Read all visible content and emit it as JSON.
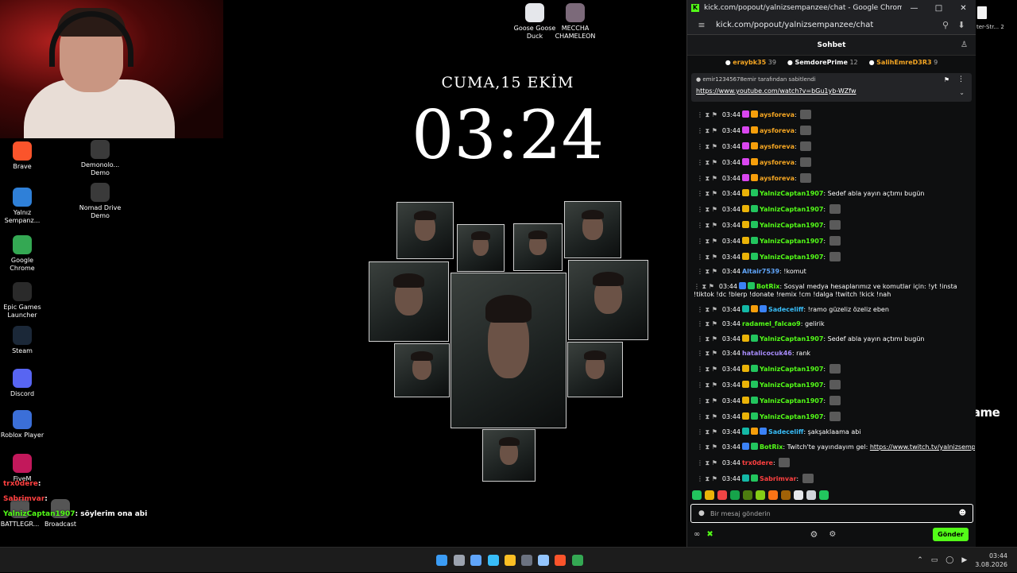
{
  "desktop": {
    "icons_left": [
      {
        "label": "Brave",
        "icon": "brave-icon",
        "color": "#fb542b"
      },
      {
        "label": "Yalnız Sempanz...",
        "icon": "chrome-icon",
        "color": "#2f80d8"
      },
      {
        "label": "Google Chrome",
        "icon": "chrome-icon",
        "color": "#34a853"
      },
      {
        "label": "Epic Games Launcher",
        "icon": "epic-games-icon",
        "color": "#2a2a2a"
      },
      {
        "label": "Steam",
        "icon": "steam-icon",
        "color": "#1b2838"
      },
      {
        "label": "Discord",
        "icon": "discord-icon",
        "color": "#5865f2"
      },
      {
        "label": "Roblox Player",
        "icon": "roblox-icon",
        "color": "#3b6fd8"
      },
      {
        "label": "FiveM",
        "icon": "fivem-icon",
        "color": "#c2185b"
      }
    ],
    "icons_col2": [
      {
        "label": "Demonolo... Demo",
        "icon": "demonologist-icon"
      },
      {
        "label": "Nomad Drive Demo",
        "icon": "nomad-drive-icon"
      }
    ],
    "icons_top": [
      {
        "label": "Goose Goose Duck",
        "icon": "goose-goose-duck-icon"
      },
      {
        "label": "MECCHA CHAMELEON",
        "icon": "meccha-chameleon-icon"
      }
    ],
    "icons_bottom": [
      {
        "label": "BATTLEGR...",
        "icon": "battlegrounds-icon"
      },
      {
        "label": "Broadcast",
        "icon": "broadcast-icon"
      }
    ],
    "clock": {
      "date": "CUMA,15 EKİM",
      "time": "03:24"
    },
    "overlay_chat": [
      {
        "user": "trx0dere",
        "sep": ":",
        "text": "",
        "color": "#ff4040"
      },
      {
        "user": "Sabrimvar",
        "sep": ":",
        "text": "",
        "color": "#ff4040"
      },
      {
        "user": "YalnizCaptan1907",
        "sep": ":",
        "text": "söylerim ona abi",
        "color": "#53fc18"
      }
    ],
    "edge_label": "ter-Str... 2",
    "watermark": "ByNoGame"
  },
  "chrome": {
    "window_title": "kick.com/popout/yalnizsempanzee/chat - Google Chrome",
    "url": "kick.com/popout/yalnizsempanzee/chat",
    "chat_title": "Sohbet",
    "leaderboard": [
      {
        "name": "eraybk35",
        "count": "39",
        "color": "#f5a623"
      },
      {
        "name": "SemdorePrime",
        "count": "12",
        "color": "#ffffff"
      },
      {
        "name": "SalihEmreD3R3",
        "count": "9",
        "color": "#f5a623"
      }
    ],
    "pinned": {
      "by": "emir12345678emir tarafından sabitlendi",
      "link": "https://www.youtube.com/watch?v=bGu1yb-WZfw"
    },
    "messages": [
      {
        "time": "03:44",
        "user": "aysforeva",
        "color": "#f5a623",
        "text": "",
        "emote": true,
        "badges": [
          "#d946ef",
          "#f59e0b"
        ]
      },
      {
        "time": "03:44",
        "user": "aysforeva",
        "color": "#f5a623",
        "text": "",
        "emote": true,
        "badges": [
          "#d946ef",
          "#f59e0b"
        ]
      },
      {
        "time": "03:44",
        "user": "aysforeva",
        "color": "#f5a623",
        "text": "",
        "emote": true,
        "badges": [
          "#d946ef",
          "#f59e0b"
        ]
      },
      {
        "time": "03:44",
        "user": "aysforeva",
        "color": "#f5a623",
        "text": "",
        "emote": true,
        "badges": [
          "#d946ef",
          "#f59e0b"
        ]
      },
      {
        "time": "03:44",
        "user": "aysforeva",
        "color": "#f5a623",
        "text": "",
        "emote": true,
        "badges": [
          "#d946ef",
          "#f59e0b"
        ]
      },
      {
        "time": "03:44",
        "user": "YalnizCaptan1907",
        "color": "#53fc18",
        "text": "Sedef abla yayın açtımı bugün",
        "emote": false,
        "badges": [
          "#eab308",
          "#22c55e"
        ]
      },
      {
        "time": "03:44",
        "user": "YalnizCaptan1907",
        "color": "#53fc18",
        "text": "",
        "emote": true,
        "badges": [
          "#eab308",
          "#22c55e"
        ]
      },
      {
        "time": "03:44",
        "user": "YalnizCaptan1907",
        "color": "#53fc18",
        "text": "",
        "emote": true,
        "badges": [
          "#eab308",
          "#22c55e"
        ]
      },
      {
        "time": "03:44",
        "user": "YalnizCaptan1907",
        "color": "#53fc18",
        "text": "",
        "emote": true,
        "badges": [
          "#eab308",
          "#22c55e"
        ]
      },
      {
        "time": "03:44",
        "user": "YalnizCaptan1907",
        "color": "#53fc18",
        "text": "",
        "emote": true,
        "badges": [
          "#eab308",
          "#22c55e"
        ]
      },
      {
        "time": "03:44",
        "user": "Altair7539",
        "color": "#60a5fa",
        "text": "!komut",
        "emote": false,
        "badges": []
      },
      {
        "time": "03:44",
        "user": "BotRix",
        "color": "#53fc18",
        "text": "Sosyal medya hesaplarımız ve komutlar için: !yt !insta !tiktok !dc !blerp !donate !remix !cm !dalga !twitch !kick !nah",
        "emote": false,
        "badges": [
          "#3b82f6",
          "#22c55e"
        ],
        "wrap": true
      },
      {
        "time": "03:44",
        "user": "Sadeceliff",
        "color": "#38bdf8",
        "text": "!ramo güzeliz özeliz eben",
        "emote": false,
        "badges": [
          "#14b8a6",
          "#f59e0b",
          "#3b82f6"
        ]
      },
      {
        "time": "03:44",
        "user": "radamel_falcao9",
        "color": "#53fc18",
        "text": "gelirik",
        "emote": false,
        "badges": []
      },
      {
        "time": "03:44",
        "user": "YalnizCaptan1907",
        "color": "#53fc18",
        "text": "Sedef abla yayın açtımı bugün",
        "emote": false,
        "badges": [
          "#eab308",
          "#22c55e"
        ]
      },
      {
        "time": "03:44",
        "user": "hatalicocuk46",
        "color": "#a78bfa",
        "text": "rank",
        "emote": false,
        "badges": []
      },
      {
        "time": "03:44",
        "user": "YalnizCaptan1907",
        "color": "#53fc18",
        "text": "",
        "emote": true,
        "badges": [
          "#eab308",
          "#22c55e"
        ]
      },
      {
        "time": "03:44",
        "user": "YalnizCaptan1907",
        "color": "#53fc18",
        "text": "",
        "emote": true,
        "badges": [
          "#eab308",
          "#22c55e"
        ]
      },
      {
        "time": "03:44",
        "user": "YalnizCaptan1907",
        "color": "#53fc18",
        "text": "",
        "emote": true,
        "badges": [
          "#eab308",
          "#22c55e"
        ]
      },
      {
        "time": "03:44",
        "user": "YalnizCaptan1907",
        "color": "#53fc18",
        "text": "",
        "emote": true,
        "badges": [
          "#eab308",
          "#22c55e"
        ]
      },
      {
        "time": "03:44",
        "user": "Sadeceliff",
        "color": "#38bdf8",
        "text": "şakşaklaama abi",
        "emote": false,
        "badges": [
          "#14b8a6",
          "#f59e0b",
          "#3b82f6"
        ]
      },
      {
        "time": "03:44",
        "user": "BotRix",
        "color": "#53fc18",
        "text": "Twitch'te yayındayım gel: ",
        "link": "https://www.twitch.tv/yalnizsempanzee",
        "emote": false,
        "badges": [
          "#3b82f6",
          "#22c55e"
        ]
      },
      {
        "time": "03:44",
        "user": "trx0dere",
        "color": "#ff4040",
        "text": "",
        "emote": true,
        "badges": []
      },
      {
        "time": "03:44",
        "user": "Sabrimvar",
        "color": "#ff4040",
        "text": "",
        "emote": true,
        "badges": [
          "#14b8a6",
          "#22c55e"
        ]
      },
      {
        "time": "03:44",
        "user": "YalnizCaptan1907",
        "color": "#53fc18",
        "text": "söylerim ona abi",
        "emote": false,
        "badges": [
          "#eab308",
          "#22c55e"
        ]
      }
    ],
    "emote_colors": [
      "#22c55e",
      "#eab308",
      "#ef4444",
      "#16a34a",
      "#4d7c0f",
      "#84cc16",
      "#f97316",
      "#a16207",
      "#e5e7eb",
      "#d1d5db",
      "#22c55e"
    ],
    "input_placeholder": "Bir mesaj gönderin",
    "send_label": "Gönder"
  },
  "taskbar": {
    "apps": [
      {
        "icon": "windows-start-icon",
        "color": "#3b9cf5"
      },
      {
        "icon": "task-view-icon",
        "color": "#9ca3af"
      },
      {
        "icon": "multitask-icon",
        "color": "#60a5fa"
      },
      {
        "icon": "widgets-icon",
        "color": "#38bdf8"
      },
      {
        "icon": "file-explorer-icon",
        "color": "#fbbf24"
      },
      {
        "icon": "obs-icon",
        "color": "#6b7280"
      },
      {
        "icon": "steam-icon",
        "color": "#93c5fd"
      },
      {
        "icon": "brave-icon",
        "color": "#fb542b"
      },
      {
        "icon": "chrome-icon",
        "color": "#34a853"
      }
    ],
    "clock_time": "03:44",
    "clock_date": "3.08.2026"
  }
}
